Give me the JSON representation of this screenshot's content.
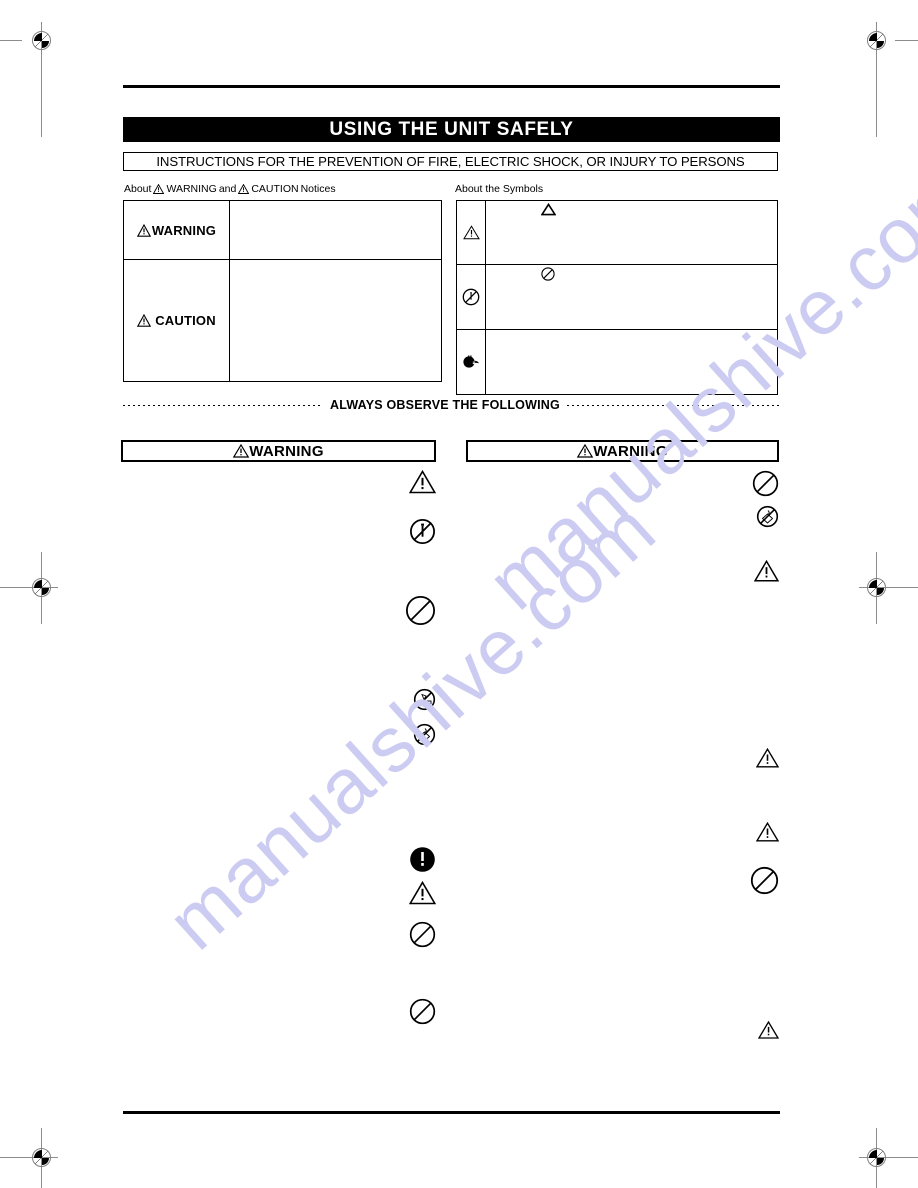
{
  "page": {
    "title": "USING THE UNIT SAFELY",
    "instructions_banner": "INSTRUCTIONS FOR THE PREVENTION OF FIRE, ELECTRIC SHOCK, OR INJURY TO PERSONS",
    "watermark": "manualshive.com",
    "watermark_color": "#ccccf2",
    "ink_color": "#000000",
    "paper_color": "#ffffff"
  },
  "captions": {
    "notices_prefix": "About",
    "notices_warning": "WARNING",
    "notices_and": "and",
    "notices_caution": "CAUTION",
    "notices_suffix": "Notices",
    "symbols": "About the Symbols"
  },
  "definition_table": {
    "rows": [
      {
        "label": "WARNING",
        "icon": "warning-triangle-icon",
        "body": ""
      },
      {
        "label": "CAUTION",
        "icon": "warning-triangle-icon",
        "body": ""
      }
    ]
  },
  "symbols_table": {
    "rows": [
      {
        "icon": "warning-triangle-icon",
        "inline_icon": "triangle-outline-icon",
        "body": ""
      },
      {
        "icon": "no-disassembly-icon",
        "inline_icon": "prohibition-circle-icon",
        "body": ""
      },
      {
        "icon": "unplug-power-icon",
        "inline_icon": "",
        "body": ""
      }
    ]
  },
  "always_observe": {
    "text": "ALWAYS OBSERVE THE FOLLOWING"
  },
  "columns": [
    {
      "header": "WARNING",
      "header_icon": "warning-triangle-icon",
      "entries": [
        {
          "icon": "warning-triangle-icon",
          "icon_size": 26,
          "text": "",
          "gap_after": 24
        },
        {
          "icon": "no-disassembly-icon",
          "icon_size": 26,
          "text": "",
          "gap_after": 50
        },
        {
          "icon": "prohibition-circle-icon",
          "icon_size": 30,
          "text": "",
          "gap_after": 62
        },
        {
          "icon": "no-bend-icon",
          "icon_size": 22,
          "text": "",
          "gap_after": 12
        },
        {
          "icon": "no-water-icon",
          "icon_size": 22,
          "text": "",
          "gap_after": 100
        },
        {
          "icon": "mandatory-exclamation-icon",
          "icon_size": 26,
          "text": "",
          "gap_after": 8
        },
        {
          "icon": "warning-triangle-icon",
          "icon_size": 26,
          "text": "",
          "gap_after": 16
        },
        {
          "icon": "prohibition-circle-icon",
          "icon_size": 26,
          "text": "",
          "gap_after": 50
        },
        {
          "icon": "prohibition-circle-icon",
          "icon_size": 26,
          "text": "",
          "gap_after": 0
        }
      ]
    },
    {
      "header": "WARNING",
      "header_icon": "warning-triangle-icon",
      "entries": [
        {
          "icon": "prohibition-circle-icon",
          "icon_size": 26,
          "text": "",
          "gap_after": 8
        },
        {
          "icon": "no-water-icon",
          "icon_size": 22,
          "text": "",
          "gap_after": 32
        },
        {
          "icon": "warning-triangle-icon",
          "icon_size": 24,
          "text": "",
          "gap_after": 166
        },
        {
          "icon": "warning-triangle-icon",
          "icon_size": 22,
          "text": "",
          "gap_after": 54
        },
        {
          "icon": "warning-triangle-icon",
          "icon_size": 22,
          "text": "",
          "gap_after": 24
        },
        {
          "icon": "prohibition-circle-icon",
          "icon_size": 28,
          "text": "",
          "gap_after": 126
        },
        {
          "icon": "warning-triangle-icon",
          "icon_size": 20,
          "text": "",
          "gap_after": 0
        }
      ]
    }
  ],
  "registration_marks": {
    "count": 6,
    "positions": [
      "top-left",
      "top-right",
      "middle-left",
      "middle-right",
      "bottom-left",
      "bottom-right"
    ]
  }
}
